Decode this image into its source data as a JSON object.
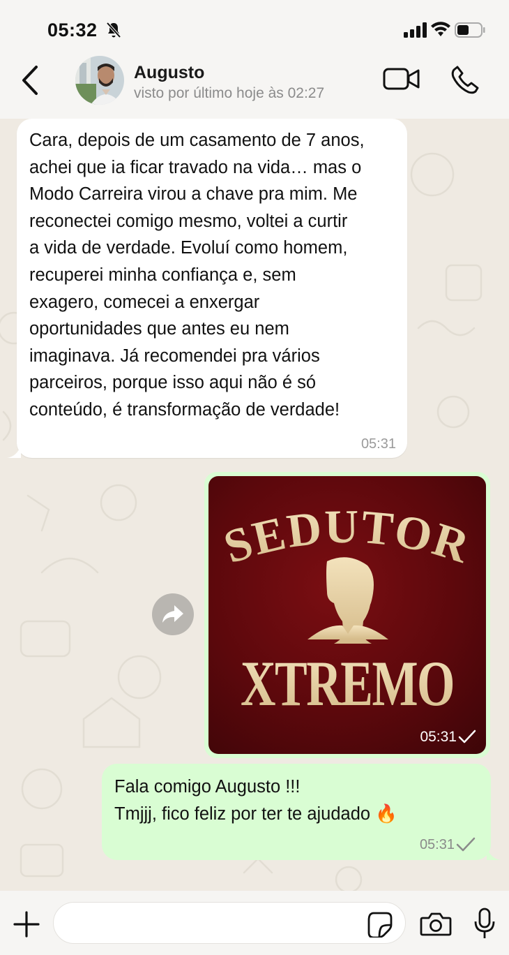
{
  "status_bar": {
    "time": "05:32",
    "icons": [
      "bell-off-icon",
      "signal-icon",
      "wifi-icon",
      "battery-icon"
    ]
  },
  "header": {
    "contact_name": "Augusto",
    "last_seen": "visto por último hoje às 02:27",
    "icons": [
      "back-icon",
      "video-call-icon",
      "phone-icon"
    ]
  },
  "messages": {
    "incoming": {
      "text": "Cara, depois de um casamento de 7 anos,\nachei que ia ficar travado na vida… mas o\nModo Carreira virou a chave pra mim. Me\nreconectei comigo mesmo, voltei a curtir\na vida de verdade. Evoluí como homem,\nrecuperei minha confiança e, sem\nexagero, comecei a enxergar\noportunidades que antes eu nem\nimaginava. Já recomendei pra vários\nparceiros, porque isso aqui não é só\nconteúdo, é transformação de verdade!",
      "time": "05:31"
    },
    "image_message": {
      "logo_line1": "SEDUTOR",
      "logo_line2": "XTREMO",
      "time": "05:31"
    },
    "outgoing": {
      "line1": "Fala comigo Augusto !!!",
      "line2": "Tmjjj, fico feliz por ter te ajudado 🔥",
      "time": "05:31"
    }
  },
  "input_bar": {
    "placeholder": "",
    "icons": [
      "plus-icon",
      "sticker-icon",
      "camera-icon",
      "mic-icon"
    ]
  },
  "colors": {
    "outgoing_bubble": "#d9fdd3",
    "incoming_bubble": "#ffffff",
    "chat_background": "#efeae2",
    "logo_background": "#5c080c",
    "logo_gold": "#e8d4a8"
  }
}
